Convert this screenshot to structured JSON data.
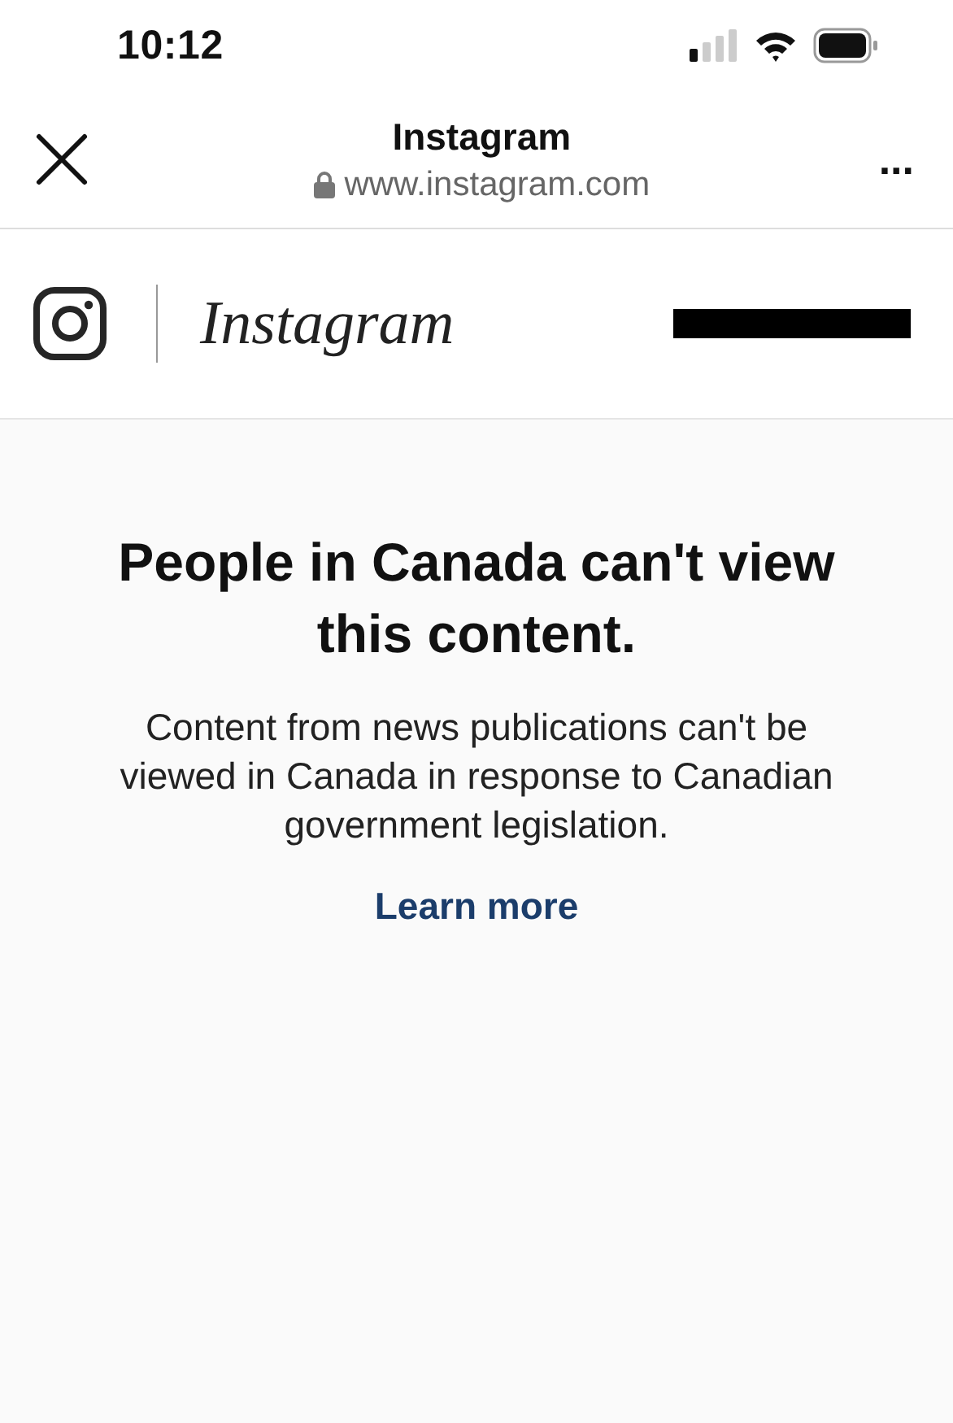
{
  "status_bar": {
    "time": "10:12"
  },
  "browser_bar": {
    "title": "Instagram",
    "url": "www.instagram.com",
    "menu": "..."
  },
  "site_header": {
    "wordmark": "Instagram"
  },
  "notice": {
    "heading": "People in Canada can't view this content.",
    "body": "Content from news publications can't be viewed in Canada in response to Canadian government legislation.",
    "link": "Learn more"
  }
}
